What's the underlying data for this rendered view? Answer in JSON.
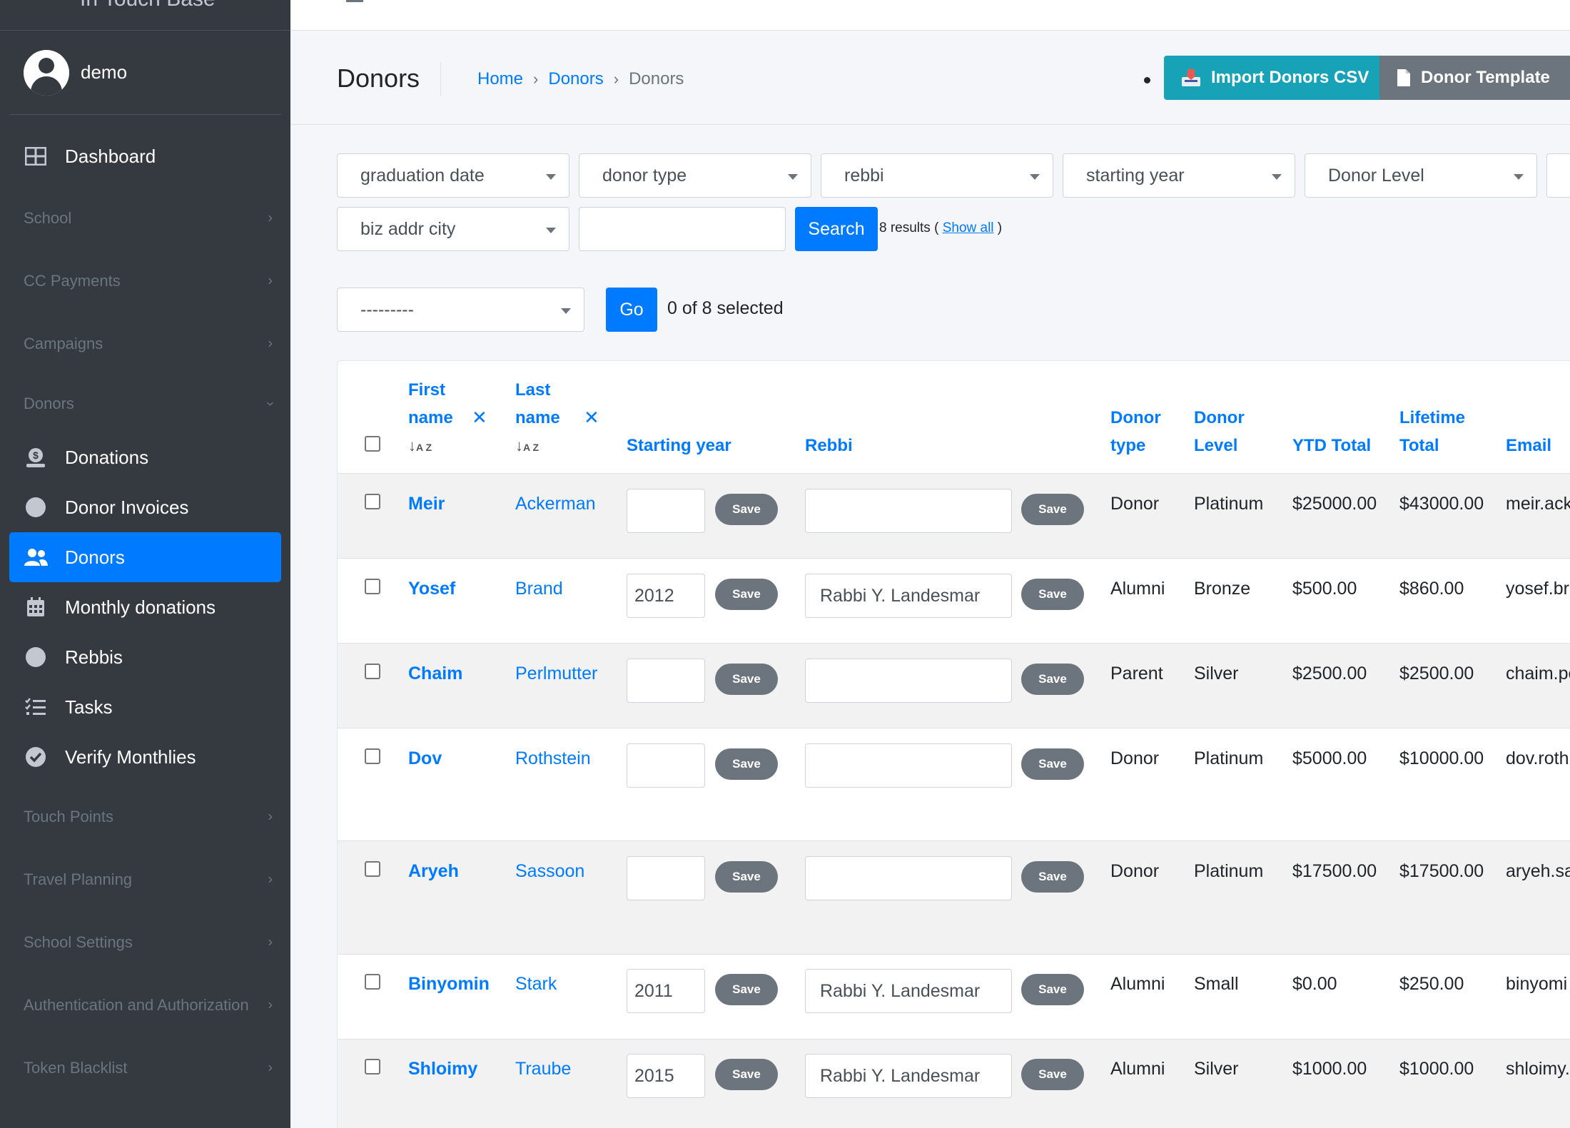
{
  "app": {
    "brand": "In Touch Base"
  },
  "user": {
    "name": "demo"
  },
  "sidebar": {
    "dashboard": "Dashboard",
    "sections": [
      {
        "label": "School"
      },
      {
        "label": "CC Payments"
      },
      {
        "label": "Campaigns"
      },
      {
        "label": "Donors"
      }
    ],
    "donor_items": [
      {
        "label": "Donations",
        "icon": "donation-icon"
      },
      {
        "label": "Donor Invoices",
        "icon": "circle-icon"
      },
      {
        "label": "Donors",
        "icon": "users-icon",
        "active": true
      },
      {
        "label": "Monthly donations",
        "icon": "calendar-icon"
      },
      {
        "label": "Rebbis",
        "icon": "circle-icon"
      },
      {
        "label": "Tasks",
        "icon": "tasks-icon"
      },
      {
        "label": "Verify Monthlies",
        "icon": "check-circle-icon"
      }
    ],
    "more_sections": [
      {
        "label": "Touch Points"
      },
      {
        "label": "Travel Planning"
      },
      {
        "label": "School Settings"
      },
      {
        "label": "Authentication and Authorization"
      },
      {
        "label": "Token Blacklist"
      }
    ]
  },
  "header": {
    "title": "Donors",
    "breadcrumb": [
      "Home",
      "Donors",
      "Donors"
    ],
    "import_button": "Import Donors CSV",
    "template_button": "Donor Template"
  },
  "filters": {
    "graduation_date": "graduation date",
    "donor_type": "donor type",
    "rebbi": "rebbi",
    "starting_year": "starting year",
    "donor_level": "Donor Level",
    "biz_addr_city": "biz addr city",
    "search_value": "",
    "search_button": "Search",
    "results_count": "8 results",
    "show_all": "Show all"
  },
  "actions": {
    "action_select": "---------",
    "go_button": "Go",
    "selected_text": "0 of 8 selected"
  },
  "table": {
    "columns": {
      "first_name_1": "First",
      "first_name_2": "name",
      "last_name_1": "Last",
      "last_name_2": "name",
      "starting_year": "Starting year",
      "rebbi": "Rebbi",
      "donor_type_1": "Donor",
      "donor_type_2": "type",
      "donor_level_1": "Donor",
      "donor_level_2": "Level",
      "ytd_total": "YTD Total",
      "lifetime_1": "Lifetime",
      "lifetime_2": "Total",
      "email": "Email"
    },
    "save_label": "Save",
    "rows": [
      {
        "first": "Meir",
        "last": "Ackerman",
        "year": "",
        "rebbi": "",
        "type": "Donor",
        "level": "Platinum",
        "ytd": "$25000.00",
        "lifetime": "$43000.00",
        "email": "meir.ack"
      },
      {
        "first": "Yosef",
        "last": "Brand",
        "year": "2012",
        "rebbi": "Rabbi Y. Landesmar",
        "type": "Alumni",
        "level": "Bronze",
        "ytd": "$500.00",
        "lifetime": "$860.00",
        "email": "yosef.bra"
      },
      {
        "first": "Chaim",
        "last": "Perlmutter",
        "year": "",
        "rebbi": "",
        "type": "Parent",
        "level": "Silver",
        "ytd": "$2500.00",
        "lifetime": "$2500.00",
        "email": "chaim.pe"
      },
      {
        "first": "Dov",
        "last": "Rothstein",
        "year": "",
        "rebbi": "",
        "type": "Donor",
        "level": "Platinum",
        "ytd": "$5000.00",
        "lifetime": "$10000.00",
        "email": "dov.roth"
      },
      {
        "first": "Aryeh",
        "last": "Sassoon",
        "year": "",
        "rebbi": "",
        "type": "Donor",
        "level": "Platinum",
        "ytd": "$17500.00",
        "lifetime": "$17500.00",
        "email": "aryeh.sa"
      },
      {
        "first": "Binyomin",
        "last": "Stark",
        "year": "2011",
        "rebbi": "Rabbi Y. Landesmar",
        "type": "Alumni",
        "level": "Small",
        "ytd": "$0.00",
        "lifetime": "$250.00",
        "email": "binyomi"
      },
      {
        "first": "Shloimy",
        "last": "Traube",
        "year": "2015",
        "rebbi": "Rabbi Y. Landesmar",
        "type": "Alumni",
        "level": "Silver",
        "ytd": "$1000.00",
        "lifetime": "$1000.00",
        "email": "shloimy."
      }
    ]
  }
}
